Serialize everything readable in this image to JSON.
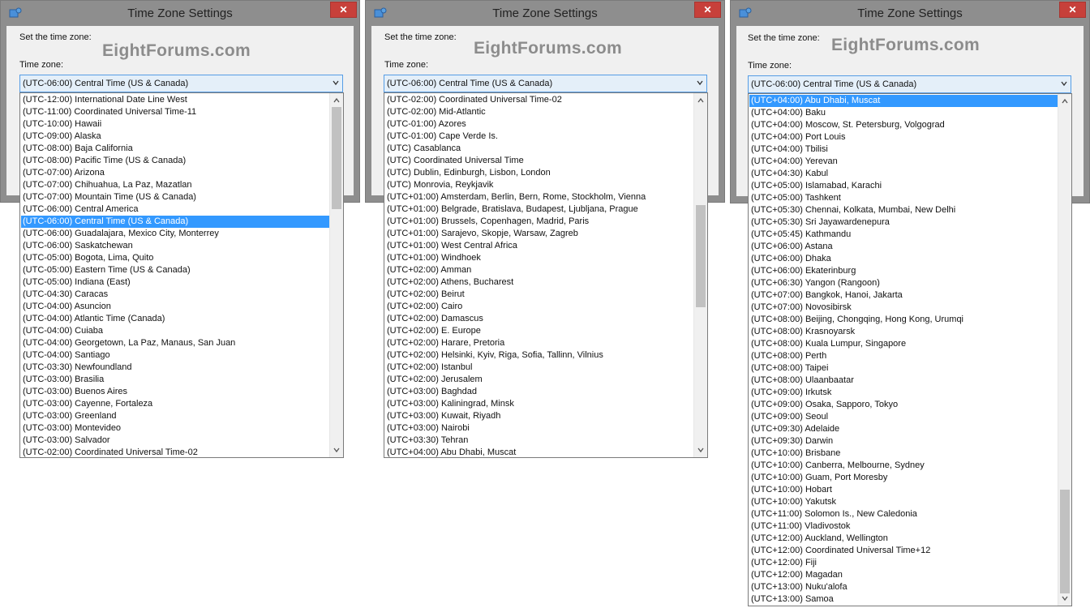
{
  "watermark": "EightForums.com",
  "window_title": "Time Zone Settings",
  "close_label": "✕",
  "set_label": "Set the time zone:",
  "tz_label": "Time zone:",
  "selected_value": "(UTC-06:00) Central Time (US & Canada)",
  "colors": {
    "selection": "#3399ff",
    "combo_bg": "#e4eff9",
    "combo_border": "#569de5",
    "close_bg": "#c7403a"
  },
  "panels": [
    {
      "selected_index": 10,
      "scroll_fraction": 0.0,
      "items": [
        "(UTC-12:00) International Date Line West",
        "(UTC-11:00) Coordinated Universal Time-11",
        "(UTC-10:00) Hawaii",
        "(UTC-09:00) Alaska",
        "(UTC-08:00) Baja California",
        "(UTC-08:00) Pacific Time (US & Canada)",
        "(UTC-07:00) Arizona",
        "(UTC-07:00) Chihuahua, La Paz, Mazatlan",
        "(UTC-07:00) Mountain Time (US & Canada)",
        "(UTC-06:00) Central America",
        "(UTC-06:00) Central Time (US & Canada)",
        "(UTC-06:00) Guadalajara, Mexico City, Monterrey",
        "(UTC-06:00) Saskatchewan",
        "(UTC-05:00) Bogota, Lima, Quito",
        "(UTC-05:00) Eastern Time (US & Canada)",
        "(UTC-05:00) Indiana (East)",
        "(UTC-04:30) Caracas",
        "(UTC-04:00) Asuncion",
        "(UTC-04:00) Atlantic Time (Canada)",
        "(UTC-04:00) Cuiaba",
        "(UTC-04:00) Georgetown, La Paz, Manaus, San Juan",
        "(UTC-04:00) Santiago",
        "(UTC-03:30) Newfoundland",
        "(UTC-03:00) Brasilia",
        "(UTC-03:00) Buenos Aires",
        "(UTC-03:00) Cayenne, Fortaleza",
        "(UTC-03:00) Greenland",
        "(UTC-03:00) Montevideo",
        "(UTC-03:00) Salvador",
        "(UTC-02:00) Coordinated Universal Time-02"
      ]
    },
    {
      "selected_index": -1,
      "scroll_fraction": 0.33,
      "items": [
        "(UTC-02:00) Coordinated Universal Time-02",
        "(UTC-02:00) Mid-Atlantic",
        "(UTC-01:00) Azores",
        "(UTC-01:00) Cape Verde Is.",
        "(UTC) Casablanca",
        "(UTC) Coordinated Universal Time",
        "(UTC) Dublin, Edinburgh, Lisbon, London",
        "(UTC) Monrovia, Reykjavik",
        "(UTC+01:00) Amsterdam, Berlin, Bern, Rome, Stockholm, Vienna",
        "(UTC+01:00) Belgrade, Bratislava, Budapest, Ljubljana, Prague",
        "(UTC+01:00) Brussels, Copenhagen, Madrid, Paris",
        "(UTC+01:00) Sarajevo, Skopje, Warsaw, Zagreb",
        "(UTC+01:00) West Central Africa",
        "(UTC+01:00) Windhoek",
        "(UTC+02:00) Amman",
        "(UTC+02:00) Athens, Bucharest",
        "(UTC+02:00) Beirut",
        "(UTC+02:00) Cairo",
        "(UTC+02:00) Damascus",
        "(UTC+02:00) E. Europe",
        "(UTC+02:00) Harare, Pretoria",
        "(UTC+02:00) Helsinki, Kyiv, Riga, Sofia, Tallinn, Vilnius",
        "(UTC+02:00) Istanbul",
        "(UTC+02:00) Jerusalem",
        "(UTC+03:00) Baghdad",
        "(UTC+03:00) Kaliningrad, Minsk",
        "(UTC+03:00) Kuwait, Riyadh",
        "(UTC+03:00) Nairobi",
        "(UTC+03:30) Tehran",
        "(UTC+04:00) Abu Dhabi, Muscat"
      ]
    },
    {
      "selected_index": 0,
      "scroll_fraction": 0.78,
      "items": [
        "(UTC+04:00) Abu Dhabi, Muscat",
        "(UTC+04:00) Baku",
        "(UTC+04:00) Moscow, St. Petersburg, Volgograd",
        "(UTC+04:00) Port Louis",
        "(UTC+04:00) Tbilisi",
        "(UTC+04:00) Yerevan",
        "(UTC+04:30) Kabul",
        "(UTC+05:00) Islamabad, Karachi",
        "(UTC+05:00) Tashkent",
        "(UTC+05:30) Chennai, Kolkata, Mumbai, New Delhi",
        "(UTC+05:30) Sri Jayawardenepura",
        "(UTC+05:45) Kathmandu",
        "(UTC+06:00) Astana",
        "(UTC+06:00) Dhaka",
        "(UTC+06:00) Ekaterinburg",
        "(UTC+06:30) Yangon (Rangoon)",
        "(UTC+07:00) Bangkok, Hanoi, Jakarta",
        "(UTC+07:00) Novosibirsk",
        "(UTC+08:00) Beijing, Chongqing, Hong Kong, Urumqi",
        "(UTC+08:00) Krasnoyarsk",
        "(UTC+08:00) Kuala Lumpur, Singapore",
        "(UTC+08:00) Perth",
        "(UTC+08:00) Taipei",
        "(UTC+08:00) Ulaanbaatar",
        "(UTC+09:00) Irkutsk",
        "(UTC+09:00) Osaka, Sapporo, Tokyo",
        "(UTC+09:00) Seoul",
        "(UTC+09:30) Adelaide",
        "(UTC+09:30) Darwin",
        "(UTC+10:00) Brisbane",
        "(UTC+10:00) Canberra, Melbourne, Sydney",
        "(UTC+10:00) Guam, Port Moresby",
        "(UTC+10:00) Hobart",
        "(UTC+10:00) Yakutsk",
        "(UTC+11:00) Solomon Is., New Caledonia",
        "(UTC+11:00) Vladivostok",
        "(UTC+12:00) Auckland, Wellington",
        "(UTC+12:00) Coordinated Universal Time+12",
        "(UTC+12:00) Fiji",
        "(UTC+12:00) Magadan",
        "(UTC+13:00) Nuku'alofa",
        "(UTC+13:00) Samoa"
      ]
    }
  ]
}
